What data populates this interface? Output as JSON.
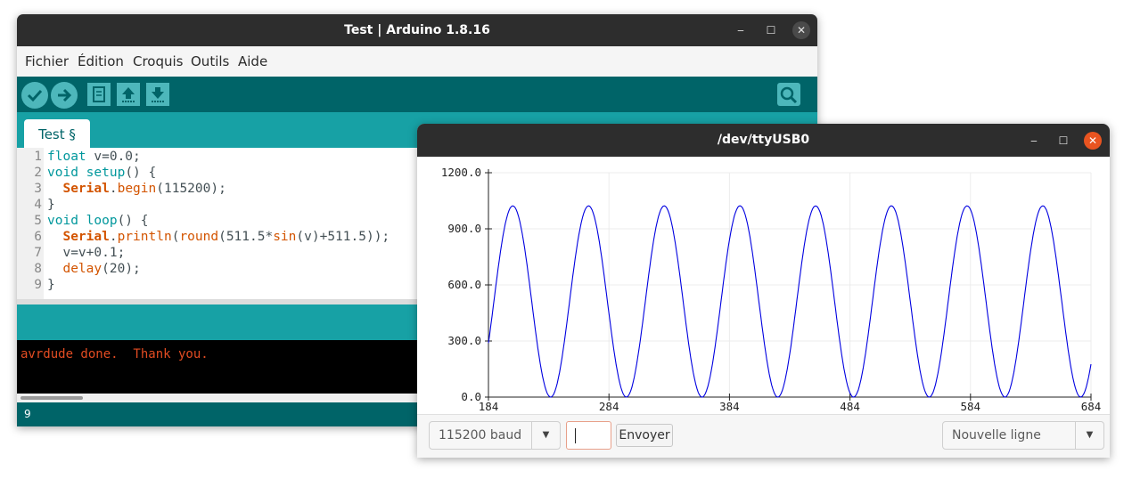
{
  "arduino": {
    "title": "Test | Arduino 1.8.16",
    "menu": [
      "Fichier",
      "Édition",
      "Croquis",
      "Outils",
      "Aide"
    ],
    "tab_label": "Test §",
    "code_lines": [
      {
        "num": "1",
        "html": "<span class=\"kw\">float</span> v=0.0;"
      },
      {
        "num": "2",
        "html": "<span class=\"kw\">void</span> <span class=\"kw\">setup</span>() {"
      },
      {
        "num": "3",
        "html": "  <span class=\"obj\">Serial</span>.<span class=\"fn\">begin</span>(115200);"
      },
      {
        "num": "4",
        "html": "}"
      },
      {
        "num": "5",
        "html": "<span class=\"kw\">void</span> <span class=\"kw\">loop</span>() {"
      },
      {
        "num": "6",
        "html": "  <span class=\"obj\">Serial</span>.<span class=\"fn\">println</span>(<span class=\"fn\">round</span>(511.5*<span class=\"fn\">sin</span>(v)+511.5));"
      },
      {
        "num": "7",
        "html": "  v=v+0.1;"
      },
      {
        "num": "8",
        "html": "  <span class=\"fn\">delay</span>(20);"
      },
      {
        "num": "9",
        "html": "}"
      }
    ],
    "console_text": "avrdude done.  Thank you.",
    "status_line": "9",
    "colors": {
      "teal_dark": "#006468",
      "teal": "#17a1a5",
      "console_text": "#e34c22"
    }
  },
  "plotter": {
    "title": "/dev/ttyUSB0",
    "baud": "115200 baud",
    "send_label": "Envoyer",
    "line_ending": "Nouvelle ligne",
    "input_value": "",
    "chart_data": {
      "type": "line",
      "x_min": 184,
      "x_max": 684,
      "ylim": [
        0,
        1200
      ],
      "x_ticks": [
        "184",
        "284",
        "384",
        "484",
        "584",
        "684"
      ],
      "y_ticks": [
        "1200.0",
        "900.0",
        "600.0",
        "300.0",
        "0.0"
      ],
      "series": [
        {
          "formula": "round(511.5*sin(v)+511.5)",
          "v_step": 0.1,
          "color": "#0000e0"
        }
      ]
    }
  }
}
